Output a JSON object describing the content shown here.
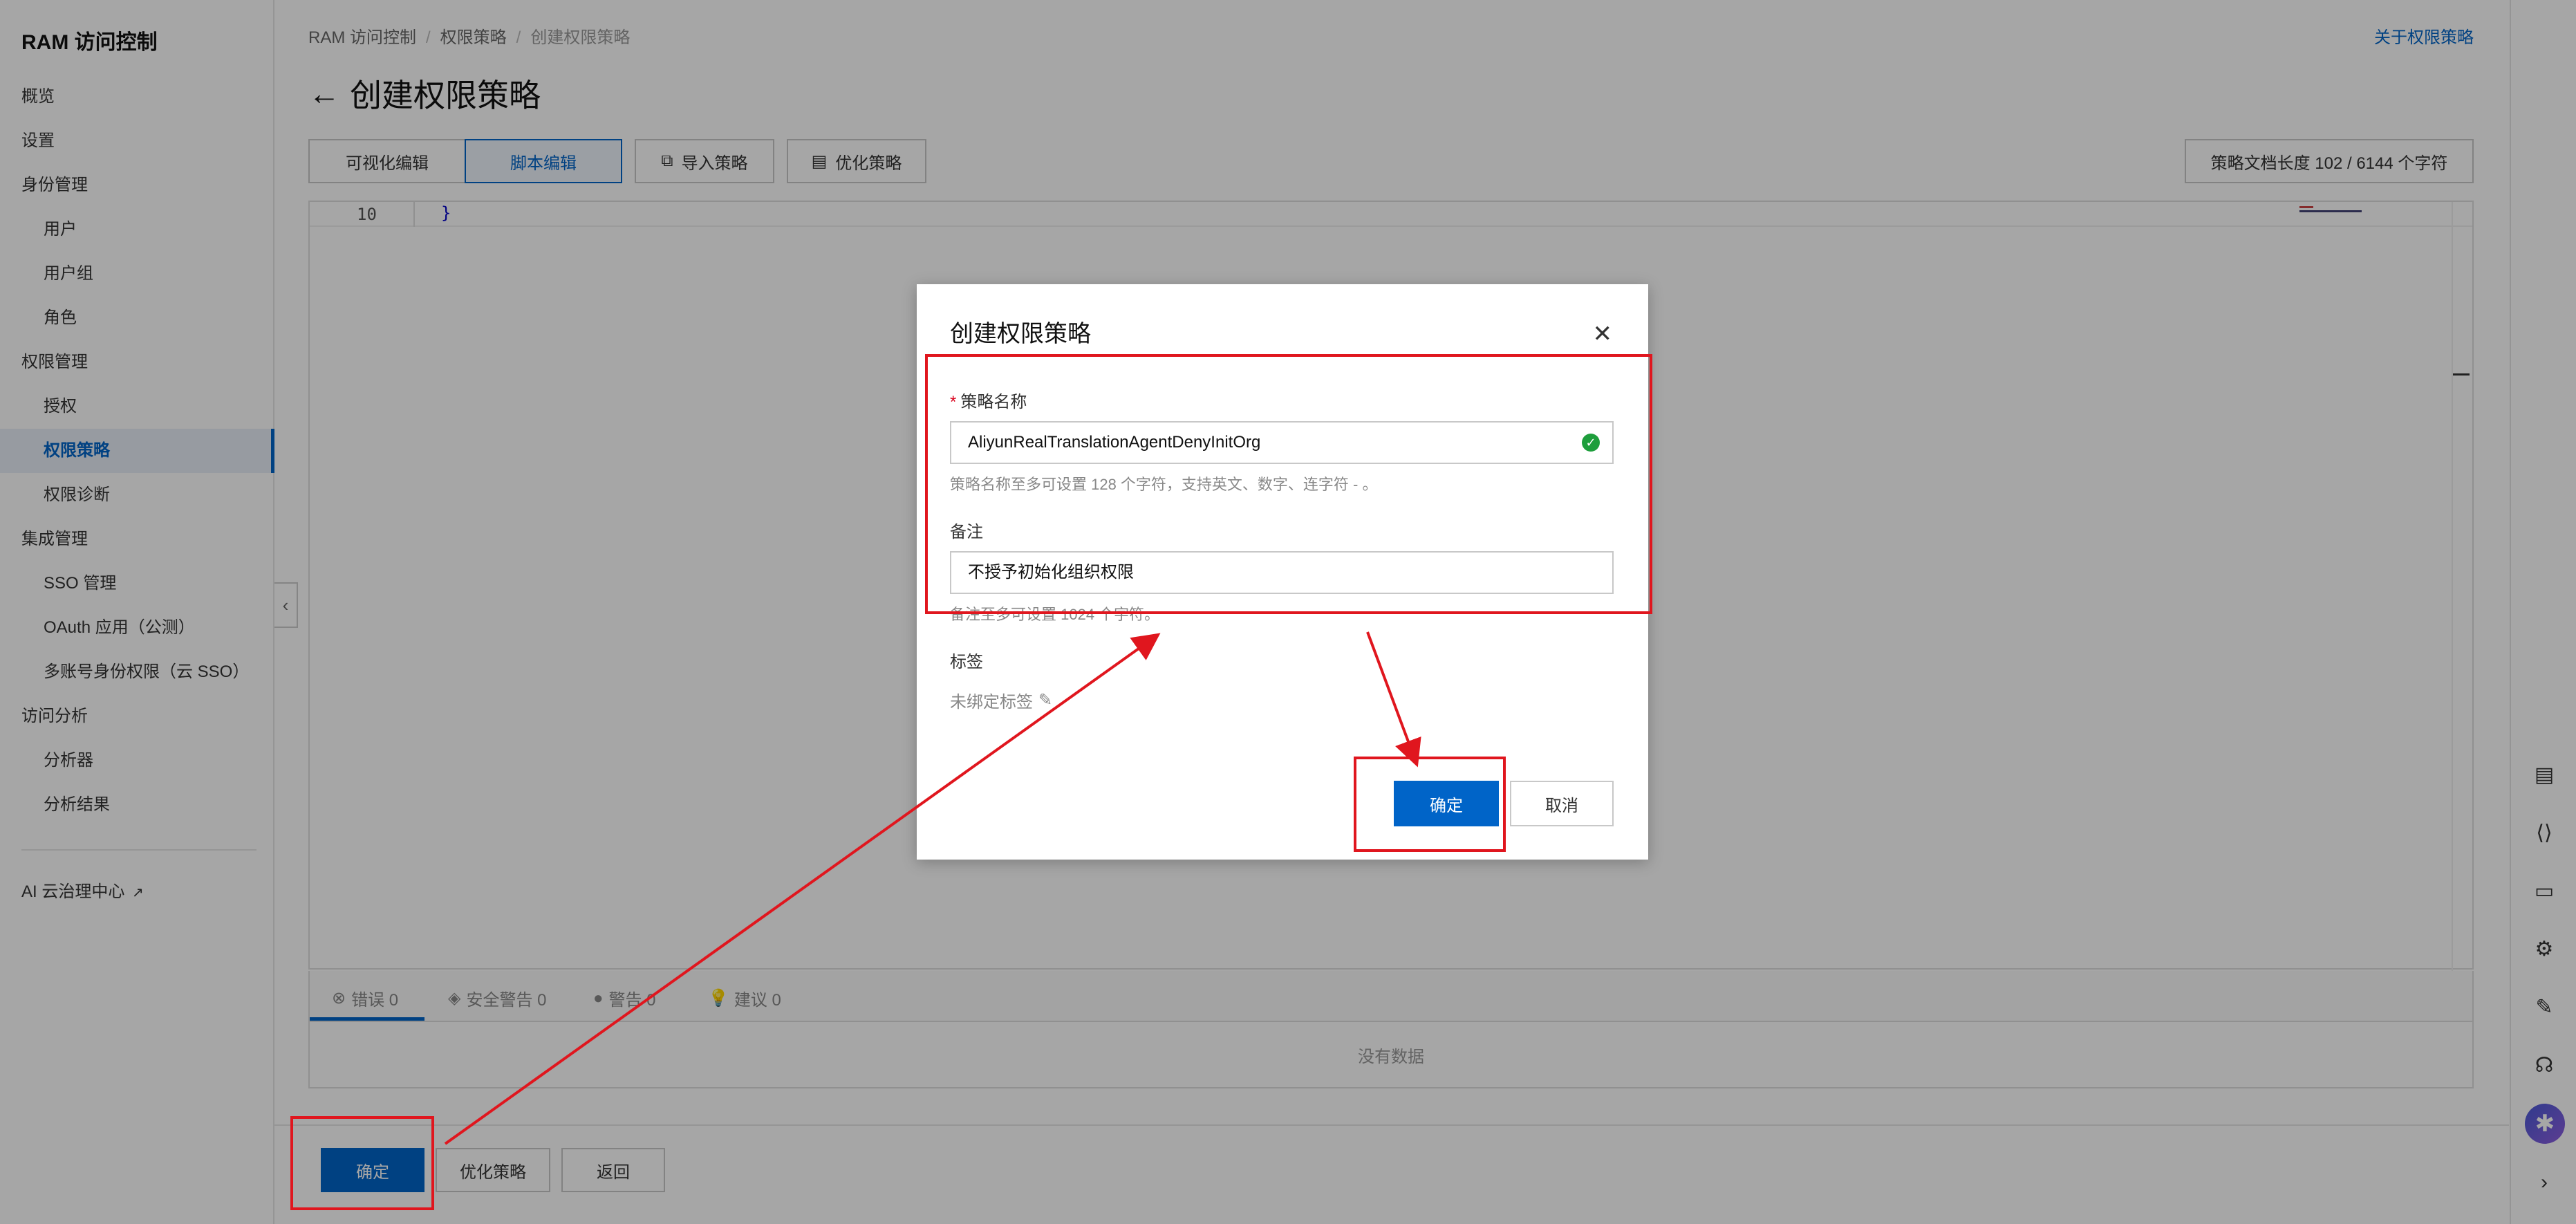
{
  "sidebar": {
    "title": "RAM 访问控制",
    "items": [
      {
        "label": "概览",
        "level": 1
      },
      {
        "label": "设置",
        "level": 1
      },
      {
        "label": "身份管理",
        "level": 1
      },
      {
        "label": "用户",
        "level": 2
      },
      {
        "label": "用户组",
        "level": 2
      },
      {
        "label": "角色",
        "level": 2
      },
      {
        "label": "权限管理",
        "level": 1
      },
      {
        "label": "授权",
        "level": 2
      },
      {
        "label": "权限策略",
        "level": 2,
        "active": true
      },
      {
        "label": "权限诊断",
        "level": 2
      },
      {
        "label": "集成管理",
        "level": 1
      },
      {
        "label": "SSO 管理",
        "level": 2
      },
      {
        "label": "OAuth 应用（公测）",
        "level": 2
      },
      {
        "label": "多账号身份权限（云 SSO）",
        "level": 2
      },
      {
        "label": "访问分析",
        "level": 1
      },
      {
        "label": "分析器",
        "level": 2
      },
      {
        "label": "分析结果",
        "level": 2
      }
    ],
    "footer_link": "AI 云治理中心"
  },
  "breadcrumb": [
    "RAM 访问控制",
    "权限策略",
    "创建权限策略"
  ],
  "about_link": "关于权限策略",
  "page_title": "创建权限策略",
  "tabs": {
    "visual": "可视化编辑",
    "script": "脚本编辑",
    "import": "导入策略",
    "optimize": "优化策略"
  },
  "doc_length": "策略文档长度 102 / 6144 个字符",
  "editor": {
    "line_number": "10",
    "code": "}"
  },
  "problems": {
    "errors": "错误 0",
    "security": "安全警告 0",
    "warnings": "警告 0",
    "suggestions": "建议 0",
    "empty": "没有数据"
  },
  "footer": {
    "confirm": "确定",
    "optimize": "优化策略",
    "back": "返回"
  },
  "modal": {
    "title": "创建权限策略",
    "name_label": "策略名称",
    "name_value": "AliyunRealTranslationAgentDenyInitOrg",
    "name_help": "策略名称至多可设置 128 个字符，支持英文、数字、连字符 - 。",
    "note_label": "备注",
    "note_value": "不授予初始化组织权限",
    "note_help": "备注至多可设置 1024 个字符。",
    "tag_label": "标签",
    "tag_empty": "未绑定标签",
    "ok": "确定",
    "cancel": "取消"
  },
  "colors": {
    "primary": "#0064c8",
    "annotation": "#e0161e"
  }
}
